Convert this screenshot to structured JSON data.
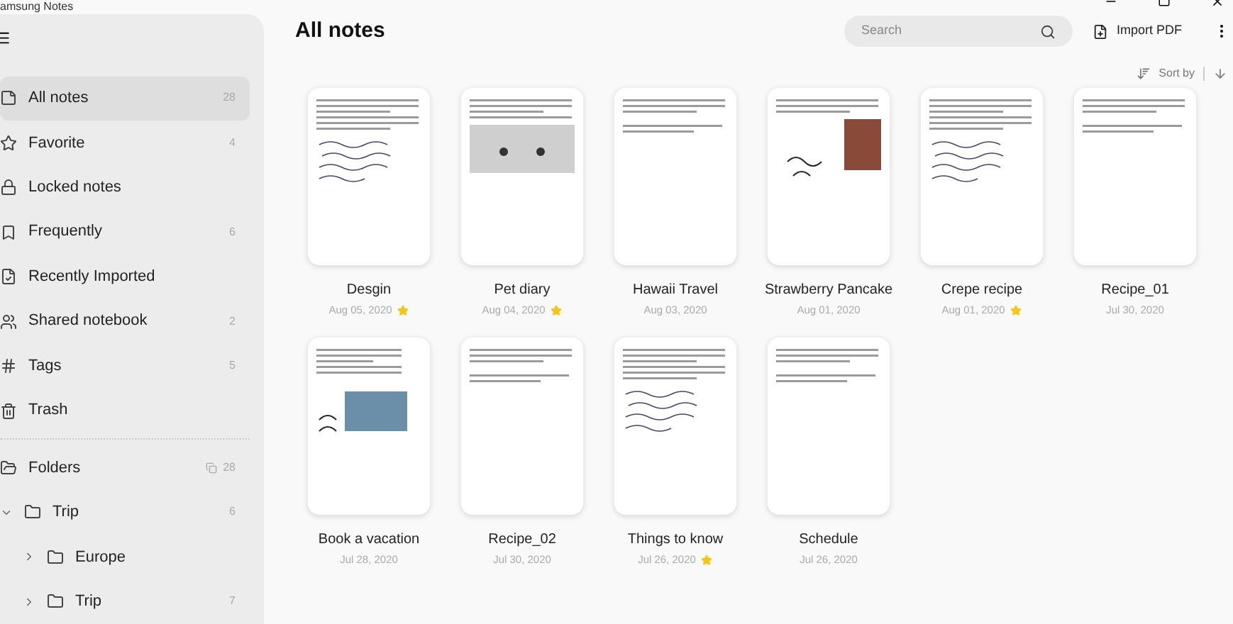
{
  "window": {
    "title": "amsung Notes"
  },
  "sidebar": {
    "items": [
      {
        "label": "All notes",
        "count": "28",
        "selected": true
      },
      {
        "label": "Favorite",
        "count": "4",
        "selected": false
      },
      {
        "label": "Locked notes",
        "selected": false
      },
      {
        "label": "Frequently",
        "count": "6",
        "selected": false
      },
      {
        "label": "Recently Imported",
        "selected": false
      },
      {
        "label": "Shared notebook",
        "count": "2",
        "selected": false
      },
      {
        "label": "Tags",
        "count": "5",
        "selected": false
      },
      {
        "label": "Trash",
        "selected": false
      }
    ],
    "folders": {
      "label": "Folders",
      "count": "28",
      "children": [
        {
          "label": "Trip",
          "count": "6",
          "expanded": true,
          "children": [
            {
              "label": "Europe",
              "expanded": false
            },
            {
              "label": "Trip",
              "count": "7",
              "expanded": false
            }
          ]
        }
      ]
    }
  },
  "header": {
    "title": "All notes",
    "search": {
      "placeholder": "Search"
    },
    "import_button": "Import PDF",
    "sort": "Sort by"
  },
  "notes": [
    {
      "title": "Desgin",
      "date": "Aug 05, 2020",
      "favorite": true,
      "kind": "handwriting"
    },
    {
      "title": "Pet diary",
      "date": "Aug 04, 2020",
      "favorite": true,
      "kind": "photo"
    },
    {
      "title": "Hawaii Travel",
      "date": "Aug 03, 2020",
      "favorite": false,
      "kind": "text"
    },
    {
      "title": "Strawberry Pancake",
      "date": "Aug 01, 2020",
      "favorite": false,
      "kind": "picture"
    },
    {
      "title": "Crepe recipe",
      "date": "Aug 01, 2020",
      "favorite": true,
      "kind": "handwriting"
    },
    {
      "title": "Recipe_01",
      "date": "Jul 30, 2020",
      "favorite": false,
      "kind": "text"
    },
    {
      "title": "Book a vacation",
      "date": "Jul 28, 2020",
      "favorite": false,
      "kind": "collage"
    },
    {
      "title": "Recipe_02",
      "date": "Jul 30, 2020",
      "favorite": false,
      "kind": "text"
    },
    {
      "title": "Things to know",
      "date": "Jul 26, 2020",
      "favorite": true,
      "kind": "handwriting"
    },
    {
      "title": "Schedule",
      "date": "Jul 26, 2020",
      "favorite": false,
      "kind": "text"
    }
  ]
}
